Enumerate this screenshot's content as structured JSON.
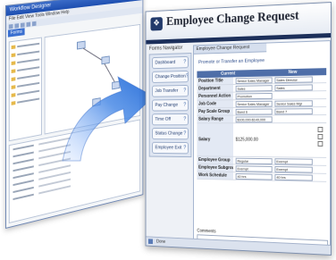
{
  "designer": {
    "title": "Workflow Designer",
    "menu": "File  Edit  View  Tools  Window  Help",
    "tab_label": "Forms"
  },
  "form": {
    "title": "Employee Change Request",
    "menu_title": "Forms Navigator",
    "side_items": [
      {
        "label": "Dashboard"
      },
      {
        "label": "Change Position"
      },
      {
        "label": "Job Transfer"
      },
      {
        "label": "Pay Change"
      },
      {
        "label": "Time Off"
      },
      {
        "label": "Status Change"
      },
      {
        "label": "Employee Exit"
      }
    ],
    "panel_tab": "Employee Change Request",
    "panel_sub": "Promote or Transfer an Employee",
    "header_cols": [
      "Current",
      "New"
    ],
    "rows": [
      {
        "key": "Position Title",
        "current": "Senior Sales Manager",
        "new": "Sales Director"
      },
      {
        "key": "Department",
        "current": "Sales",
        "new": "Sales"
      },
      {
        "key": "Personnel Action",
        "current": "Promotion",
        "new": ""
      },
      {
        "key": "Job Code",
        "current": "Senior Sales Manager",
        "new": "Senior Sales Mgr"
      },
      {
        "key": "Pay Scale Group",
        "current": "Band 6",
        "new": "Band 7"
      },
      {
        "key": "Salary Range",
        "current": "$100,000-$140,000",
        "new": ""
      }
    ],
    "salary_label": "Salary",
    "salary_value": "$125,000.00",
    "more_rows": [
      {
        "key": "Employee Group",
        "current": "Regular",
        "new": "Exempt"
      },
      {
        "key": "Employee Subgroup",
        "current": "Exempt",
        "new": "Exempt"
      },
      {
        "key": "Work Schedule",
        "current": "40 hrs",
        "new": "40 hrs"
      }
    ],
    "comments_label": "Comments",
    "status_text": "Done"
  }
}
